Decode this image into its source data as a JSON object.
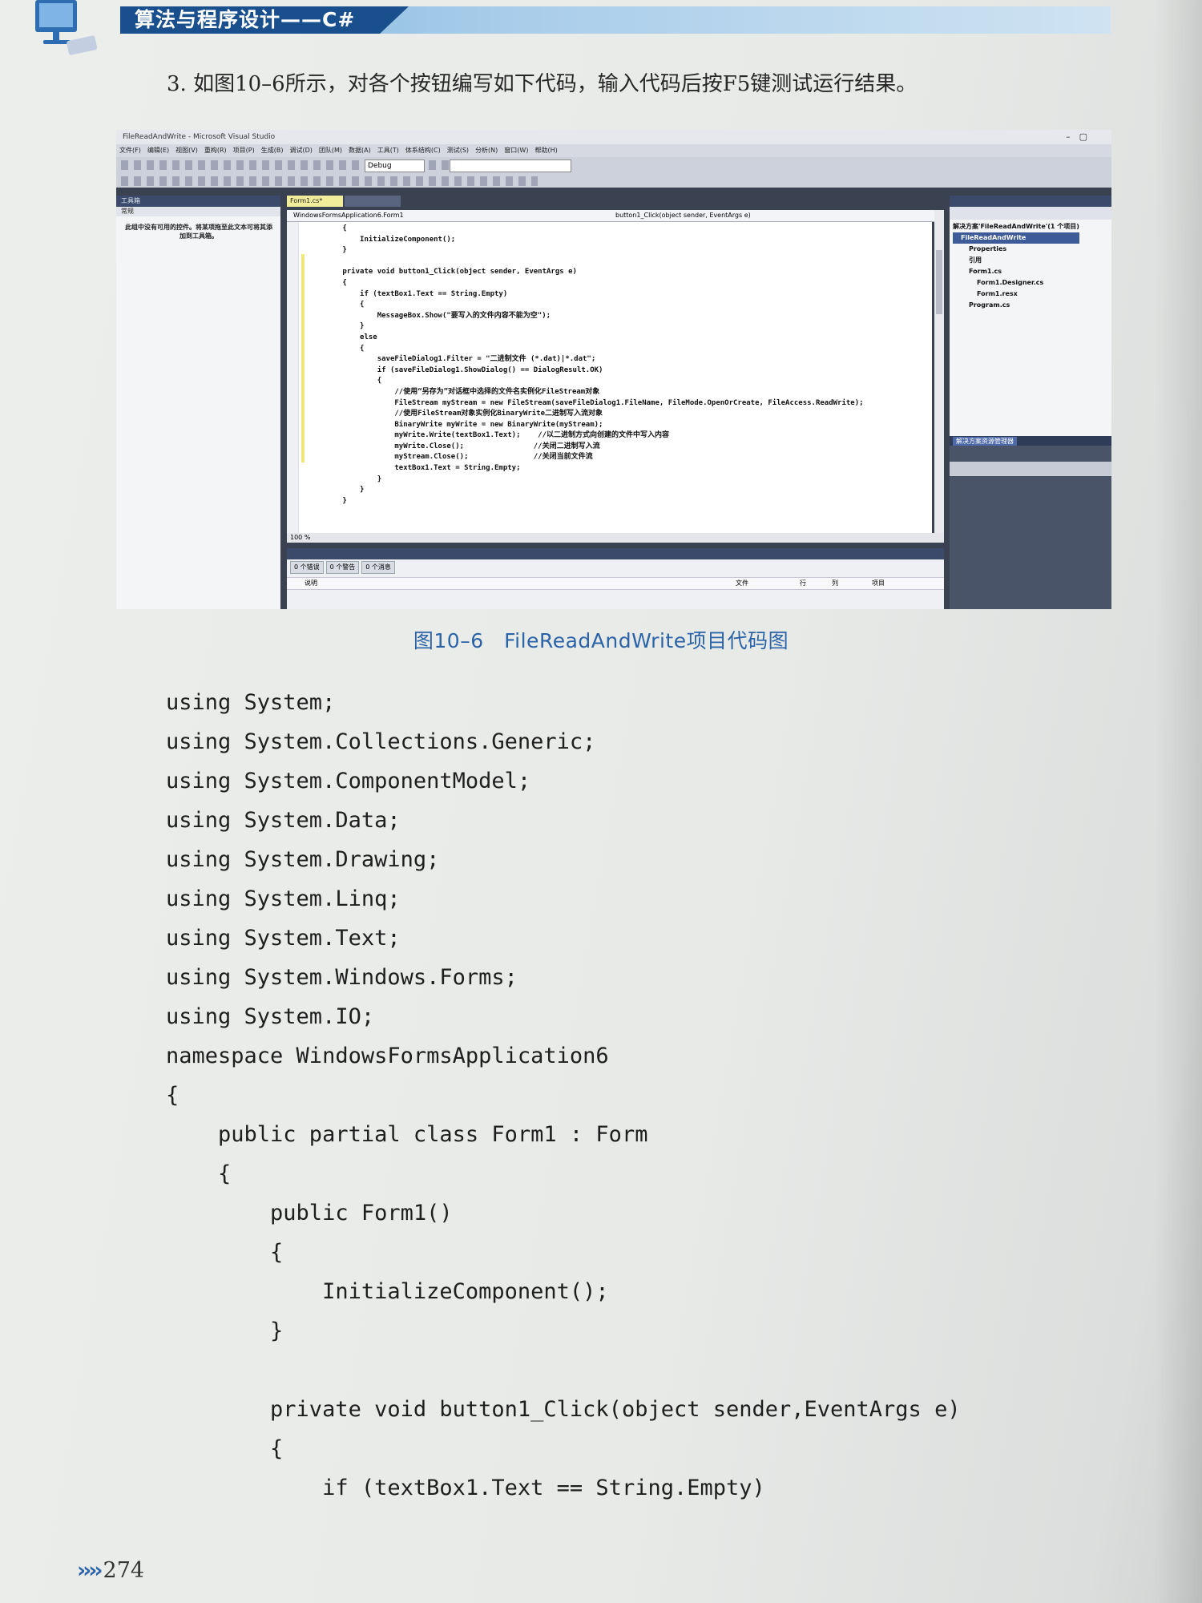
{
  "header": {
    "book_title": "算法与程序设计——C#"
  },
  "instruction": "3. 如图10–6所示，对各个按钮编写如下代码，输入代码后按F5键测试运行结果。",
  "ide": {
    "window_title": "FileReadAndWrite - Microsoft Visual Studio",
    "menu": [
      "文件(F)",
      "编辑(E)",
      "视图(V)",
      "重构(R)",
      "项目(P)",
      "生成(B)",
      "调试(D)",
      "团队(M)",
      "数据(A)",
      "工具(T)",
      "体系结构(C)",
      "测试(S)",
      "分析(N)",
      "窗口(W)",
      "帮助(H)"
    ],
    "config": "Debug",
    "toolbox_title": "工具箱",
    "toolbox_group": "常规",
    "toolbox_message": "此组中没有可用的控件。将某项拖至此文本可将其添加到工具箱。",
    "editor_tab": "Form1.cs*",
    "nav_class": "WindowsFormsApplication6.Form1",
    "nav_method": "button1_Click(object sender, EventArgs e)",
    "code": [
      "        {",
      "            InitializeComponent();",
      "        }",
      "",
      "        private void button1_Click(object sender, EventArgs e)",
      "        {",
      "            if (textBox1.Text == String.Empty)",
      "            {",
      "                MessageBox.Show(\"要写入的文件内容不能为空\");",
      "            }",
      "            else",
      "            {",
      "                saveFileDialog1.Filter = \"二进制文件 (*.dat)|*.dat\";",
      "                if (saveFileDialog1.ShowDialog() == DialogResult.OK)",
      "                {",
      "                    //使用“另存为”对话框中选择的文件名实例化FileStream对象",
      "                    FileStream myStream = new FileStream(saveFileDialog1.FileName, FileMode.OpenOrCreate, FileAccess.ReadWrite);",
      "                    //使用FileStream对象实例化BinaryWrite二进制写入流对象",
      "                    BinaryWrite myWrite = new BinaryWrite(myStream);",
      "                    myWrite.Write(textBox1.Text);    //以二进制方式向创建的文件中写入内容",
      "                    myWrite.Close();                //关闭二进制写入流",
      "                    myStream.Close();               //关闭当前文件流",
      "                    textBox1.Text = String.Empty;",
      "                }",
      "            }",
      "        }"
    ],
    "zoom": "100 %",
    "solution_tree": [
      {
        "label": "解决方案'FileReadAndWrite'(1 个项目)",
        "indent": 0,
        "selected": false
      },
      {
        "label": "FileReadAndWrite",
        "indent": 1,
        "selected": true
      },
      {
        "label": "Properties",
        "indent": 2,
        "selected": false
      },
      {
        "label": "引用",
        "indent": 2,
        "selected": false
      },
      {
        "label": "Form1.cs",
        "indent": 2,
        "selected": false
      },
      {
        "label": "Form1.Designer.cs",
        "indent": 3,
        "selected": false
      },
      {
        "label": "Form1.resx",
        "indent": 3,
        "selected": false
      },
      {
        "label": "Program.cs",
        "indent": 2,
        "selected": false
      }
    ],
    "solution_tab": "解决方案资源管理器",
    "error_filters": [
      "0 个错误",
      "0 个警告",
      "0 个消息"
    ],
    "error_columns": [
      "说明",
      "文件",
      "行",
      "列",
      "项目"
    ]
  },
  "figure_caption": "图10–6　FileReadAndWrite项目代码图",
  "code_listing": [
    "using System;",
    "using System.Collections.Generic;",
    "using System.ComponentModel;",
    "using System.Data;",
    "using System.Drawing;",
    "using System.Linq;",
    "using System.Text;",
    "using System.Windows.Forms;",
    "using System.IO;",
    "namespace WindowsFormsApplication6",
    "{",
    "    public partial class Form1 : Form",
    "    {",
    "        public Form1()",
    "        {",
    "            InitializeComponent();",
    "        }",
    "",
    "        private void button1_Click(object sender,EventArgs e)",
    "        {",
    "            if (textBox1.Text == String.Empty)"
  ],
  "footer": {
    "arrows": "››››",
    "page_number": "274"
  }
}
